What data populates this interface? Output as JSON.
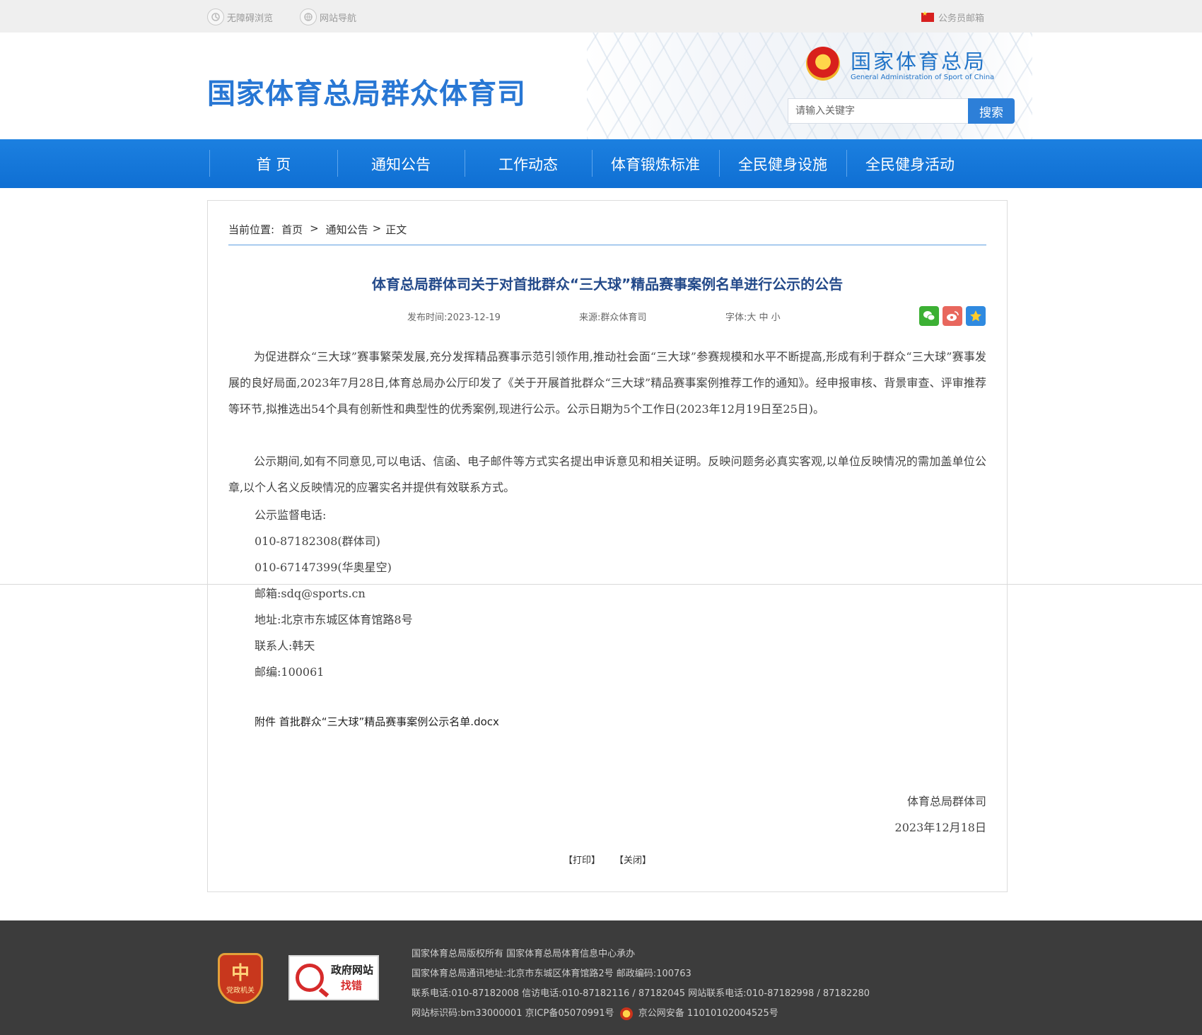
{
  "topbar": {
    "accessibility": "无障碍浏览",
    "site_nav": "网站导航",
    "mail": "公务员邮箱"
  },
  "header": {
    "site_title": "国家体育总局群众体育司",
    "org_cn": "国家体育总局",
    "org_en": "General Administration of Sport of China",
    "search_placeholder": "请输入关键字",
    "search_button": "搜索"
  },
  "nav": [
    "首 页",
    "通知公告",
    "工作动态",
    "体育锻炼标准",
    "全民健身设施",
    "全民健身活动"
  ],
  "breadcrumb": {
    "prefix": "当前位置:",
    "home": "首页",
    "sep1": ">",
    "section": "通知公告",
    "sep2": ">",
    "current": "正文"
  },
  "article": {
    "title": "体育总局群体司关于对首批群众“三大球”精品赛事案例名单进行公示的公告",
    "publish": "发布时间:2023-12-19",
    "source": "来源:群众体育司",
    "font_size": "字体:大 中 小",
    "paragraphs": [
      "为促进群众“三大球”赛事繁荣发展,充分发挥精品赛事示范引领作用,推动社会面“三大球”参赛规模和水平不断提高,形成有利于群众“三大球”赛事发展的良好局面,2023年7月28日,体育总局办公厅印发了《关于开展首批群众“三大球”精品赛事案例推荐工作的通知》。经申报审核、背景审查、评审推荐等环节,拟推选出54个具有创新性和典型性的优秀案例,现进行公示。公示日期为5个工作日(2023年12月19日至25日)。",
      "公示期间,如有不同意见,可以电话、信函、电子邮件等方式实名提出申诉意见和相关证明。反映问题务必真实客观,以单位反映情况的需加盖单位公章,以个人名义反映情况的应署实名并提供有效联系方式。"
    ],
    "contact_lines": [
      "公示监督电话:",
      "010-87182308(群体司)",
      "010-67147399(华奥星空)",
      "邮箱:sdq@sports.cn",
      "地址:北京市东城区体育馆路8号",
      "联系人:韩天",
      "邮编:100061"
    ],
    "attachment": "附件 首批群众“三大球”精品赛事案例公示名单.docx",
    "signature_org": "体育总局群体司",
    "signature_date": "2023年12月18日",
    "print": "【打印】",
    "close": "【关闭】"
  },
  "footer": {
    "party_badge": "党政机关",
    "gov_badge_line1": "政府网站",
    "gov_badge_line2": "找错",
    "line1": "国家体育总局版权所有  国家体育总局体育信息中心承办",
    "line2": "国家体育总局通讯地址:北京市东城区体育馆路2号  邮政编码:100763",
    "line3": "联系电话:010-87182008  信访电话:010-87182116 / 87182045     网站联系电话:010-87182998 / 87182280",
    "line4a": "网站标识码:bm33000001 京ICP备05070991号",
    "line4b": "京公网安备 11010102004525号"
  }
}
